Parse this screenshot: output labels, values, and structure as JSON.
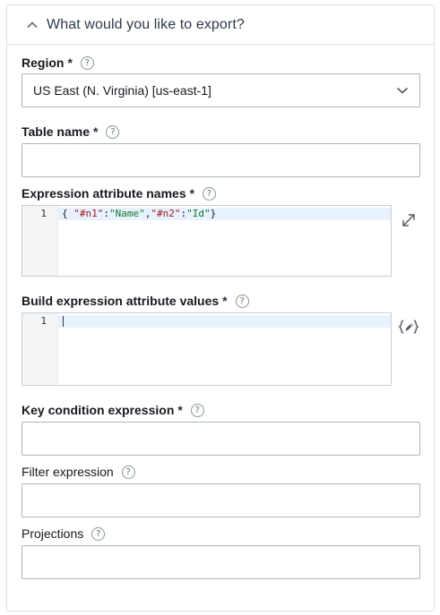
{
  "section": {
    "title": "What would you like to export?",
    "collapse_icon": "chevron-up-icon"
  },
  "required_marker": "*",
  "help_glyph": "?",
  "fields": {
    "region": {
      "label": "Region",
      "value": "US East (N. Virginia) [us-east-1]",
      "caret_icon": "chevron-down-icon"
    },
    "table_name": {
      "label": "Table name",
      "value": ""
    },
    "expression_attribute_names": {
      "label": "Expression attribute names",
      "line_number": "1",
      "code": {
        "open": "{",
        "key1": "\"#n1\"",
        "colon": ":",
        "val1": "\"Name\"",
        "comma": ",",
        "key2": "\"#n2\"",
        "val2": "\"Id\"",
        "close": "}"
      },
      "expand_icon": "expand-icon"
    },
    "build_expression_attribute_values": {
      "label": "Build expression attribute values",
      "line_number": "1",
      "code": "",
      "edit_icon": "edit-json-icon"
    },
    "key_condition_expression": {
      "label": "Key condition expression",
      "value": ""
    },
    "filter_expression": {
      "label": "Filter expression",
      "value": ""
    },
    "projections": {
      "label": "Projections",
      "value": ""
    }
  },
  "colors": {
    "border": "#aab7b8",
    "panel_border": "#dde3ea",
    "active_line": "#e8f2ff",
    "json_key": "#a31515",
    "json_string": "#0f7a2a"
  }
}
